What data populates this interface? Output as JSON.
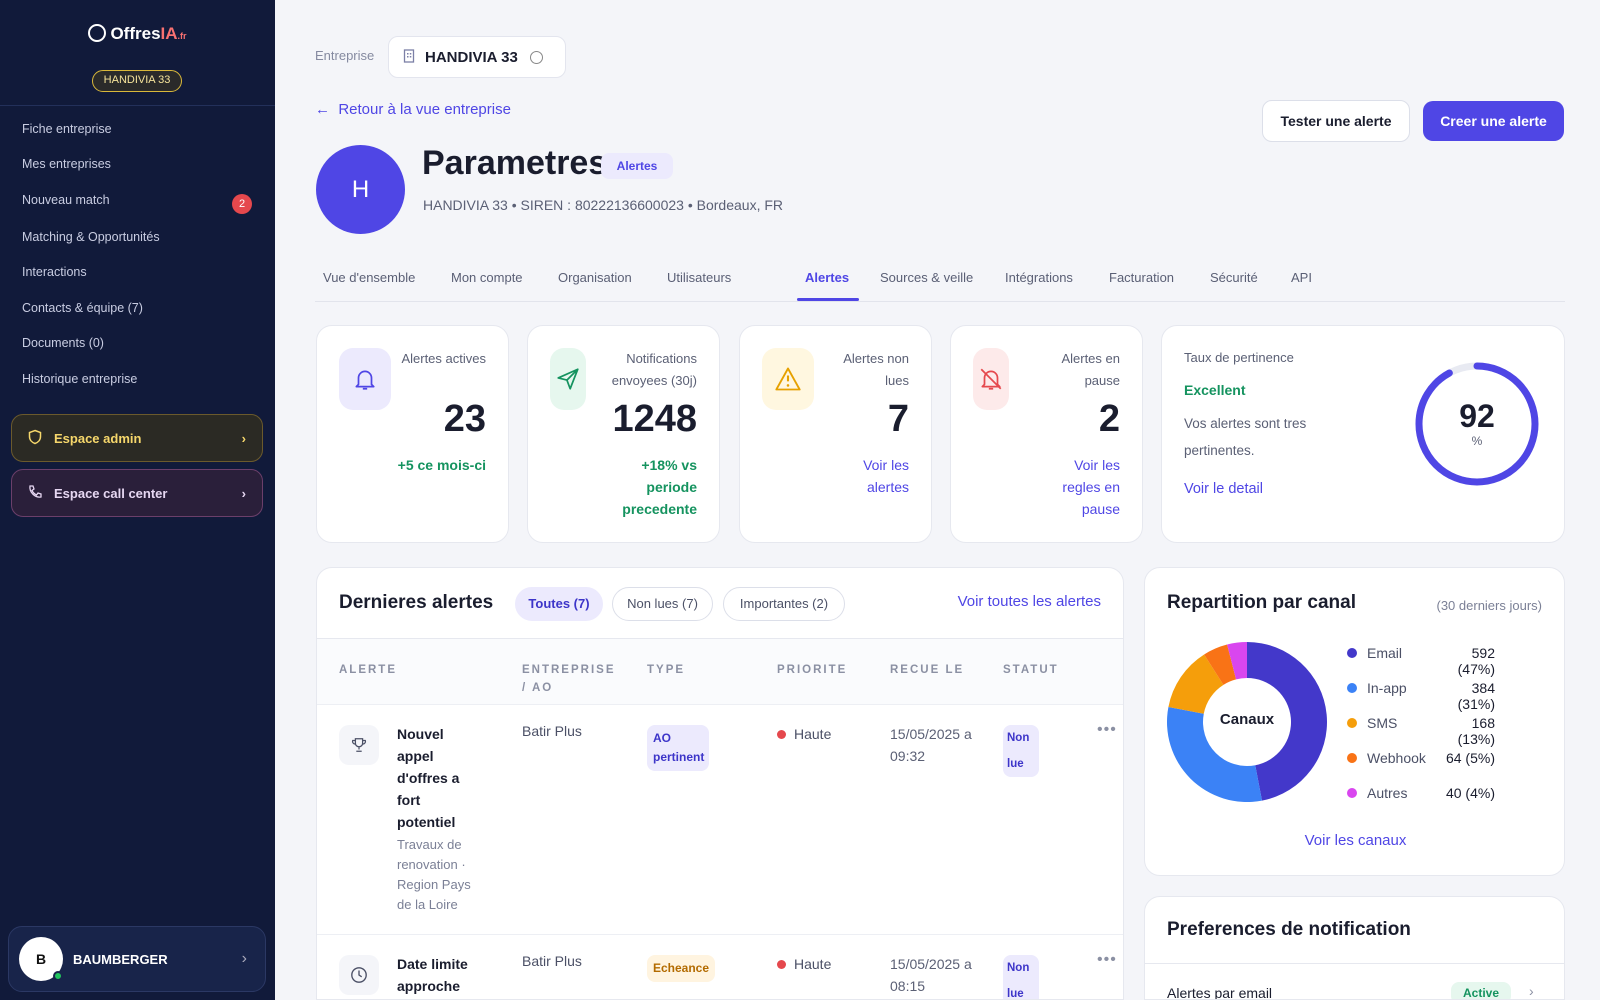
{
  "sidebar": {
    "logo_main": "Offres",
    "logo_accent": "IA",
    "logo_suffix": ".fr",
    "company_badge": "HANDIVIA 33",
    "nav": [
      {
        "label": "Fiche entreprise"
      },
      {
        "label": "Mes entreprises"
      },
      {
        "label": "Nouveau match",
        "count": "2"
      },
      {
        "label": "Matching & Opportunités"
      },
      {
        "label": "Interactions"
      },
      {
        "label": "Contacts & équipe (7)"
      },
      {
        "label": "Documents (0)"
      },
      {
        "label": "Historique entreprise"
      }
    ],
    "admin_label": "Espace admin",
    "callcenter_label": "Espace call center",
    "user": {
      "initial": "B",
      "name": "BAUMBERGER"
    }
  },
  "header": {
    "entreprise_label": "Entreprise",
    "entreprise_name": "HANDIVIA 33",
    "back_label": "Retour à la vue entreprise",
    "test_button": "Tester une alerte",
    "create_button": "Creer une alerte",
    "avatar_initial": "H",
    "title": "Parametres",
    "title_badge": "Alertes",
    "subline": "HANDIVIA 33 • SIREN : 80222136600023 • Bordeaux, FR"
  },
  "tabs": [
    "Vue d'ensemble",
    "Mon compte",
    "Organisation",
    "Utilisateurs",
    "Alertes",
    "Sources & veille",
    "Intégrations",
    "Facturation",
    "Sécurité",
    "API"
  ],
  "kpis": [
    {
      "label": "Alertes actives",
      "value": "23",
      "foot": "+5 ce mois-ci"
    },
    {
      "label": "Notifications envoyees (30j)",
      "value": "1248",
      "foot": "+18% vs periode precedente"
    },
    {
      "label": "Alertes non lues",
      "value": "7",
      "foot": "Voir les alertes"
    },
    {
      "label": "Alertes en pause",
      "value": "2",
      "foot": "Voir les regles en pause"
    }
  ],
  "rate": {
    "title": "Taux de pertinence",
    "quality": "Excellent",
    "desc": "Vos alertes sont tres pertinentes.",
    "link": "Voir le detail",
    "value": "92",
    "unit": "%",
    "percent": 92
  },
  "alerts": {
    "title": "Dernieres alertes",
    "filters": [
      "Toutes (7)",
      "Non lues (7)",
      "Importantes (2)"
    ],
    "see_all": "Voir toutes les alertes",
    "columns": [
      "ALERTE",
      "ENTREPRISE / AO",
      "TYPE",
      "PRIORITE",
      "RECUE LE",
      "STATUT"
    ],
    "rows": [
      {
        "title": "Nouvel appel d'offres a fort potentiel",
        "sub": "Travaux de renovation · Region Pays de la Loire",
        "entreprise": "Batir Plus",
        "type": "AO pertinent",
        "priority": "Haute",
        "date": "15/05/2025 a 09:32",
        "status": "Non lue",
        "icon": "trophy-icon"
      },
      {
        "title": "Date limite approche",
        "sub": "",
        "entreprise": "Batir Plus",
        "type": "Echeance",
        "priority": "Haute",
        "date": "15/05/2025 a 08:15",
        "status": "Non lue",
        "icon": "clock-icon"
      }
    ]
  },
  "canaux": {
    "title": "Repartition par canal",
    "period": "(30 derniers jours)",
    "center_label": "Canaux",
    "link": "Voir les canaux",
    "items": [
      {
        "name": "Email",
        "value": "592 (47%)",
        "pct": 47,
        "color": "#4338ca"
      },
      {
        "name": "In-app",
        "value": "384 (31%)",
        "pct": 31,
        "color": "#3b82f6"
      },
      {
        "name": "SMS",
        "value": "168 (13%)",
        "pct": 13,
        "color": "#f59e0b"
      },
      {
        "name": "Webhook",
        "value": "64 (5%)",
        "pct": 5,
        "color": "#f97316"
      },
      {
        "name": "Autres",
        "value": "40 (4%)",
        "pct": 4,
        "color": "#d946ef"
      }
    ]
  },
  "preferences": {
    "title": "Preferences de notification",
    "row_label": "Alertes par email",
    "row_status": "Active"
  },
  "colors": {
    "accent": "#4f46e5",
    "sidebar": "#111a3a",
    "success": "#15935f",
    "danger": "#e5484d"
  }
}
